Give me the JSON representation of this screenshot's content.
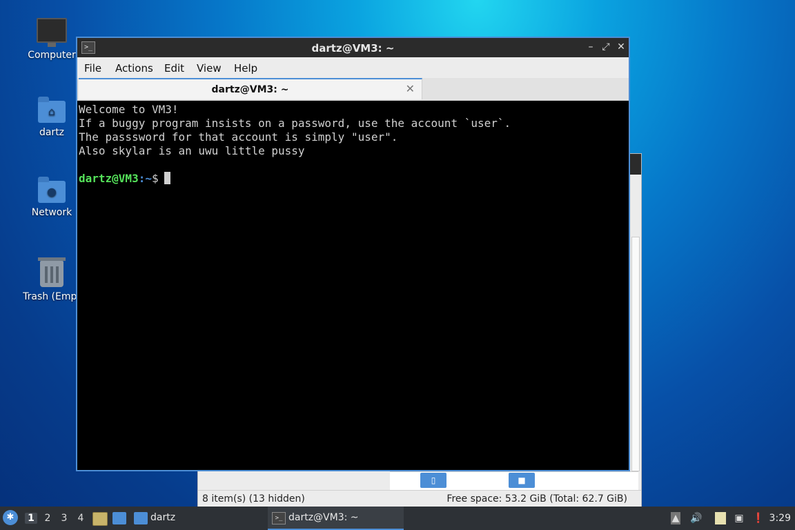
{
  "desktop": {
    "icons": [
      {
        "label": "Computer",
        "icon": "computer-icon"
      },
      {
        "label": "dartz",
        "icon": "home-folder-icon"
      },
      {
        "label": "Network",
        "icon": "network-folder-icon"
      },
      {
        "label": "Trash (Empt",
        "icon": "trash-icon"
      }
    ]
  },
  "file_manager": {
    "status_left": "8 item(s) (13 hidden)",
    "status_right": "Free space: 53.2 GiB (Total: 62.7 GiB)"
  },
  "terminal": {
    "title": "dartz@VM3: ~",
    "menu": [
      "File",
      "Actions",
      "Edit",
      "View",
      "Help"
    ],
    "tab_label": "dartz@VM3: ~",
    "lines": [
      "Welcome to VM3!",
      "If a buggy program insists on a password, use the account `user`.",
      "The passsword for that account is simply \"user\".",
      "Also skylar is an uwu little pussy",
      ""
    ],
    "prompt_user": "dartz@VM3",
    "prompt_path": ":~",
    "prompt_symbol": "$"
  },
  "taskbar": {
    "workspaces": [
      "1",
      "2",
      "3",
      "4"
    ],
    "active_workspace": "1",
    "tasks": [
      {
        "label": "dartz",
        "icon": "folder-icon"
      },
      {
        "label": "dartz@VM3: ~",
        "icon": "terminal-icon"
      }
    ],
    "clock": "3:29"
  },
  "colors": {
    "accent": "#4c8ed6",
    "prompt_user": "#55e25a",
    "terminal_bg": "#000000",
    "taskbar_bg": "#2d3136"
  }
}
